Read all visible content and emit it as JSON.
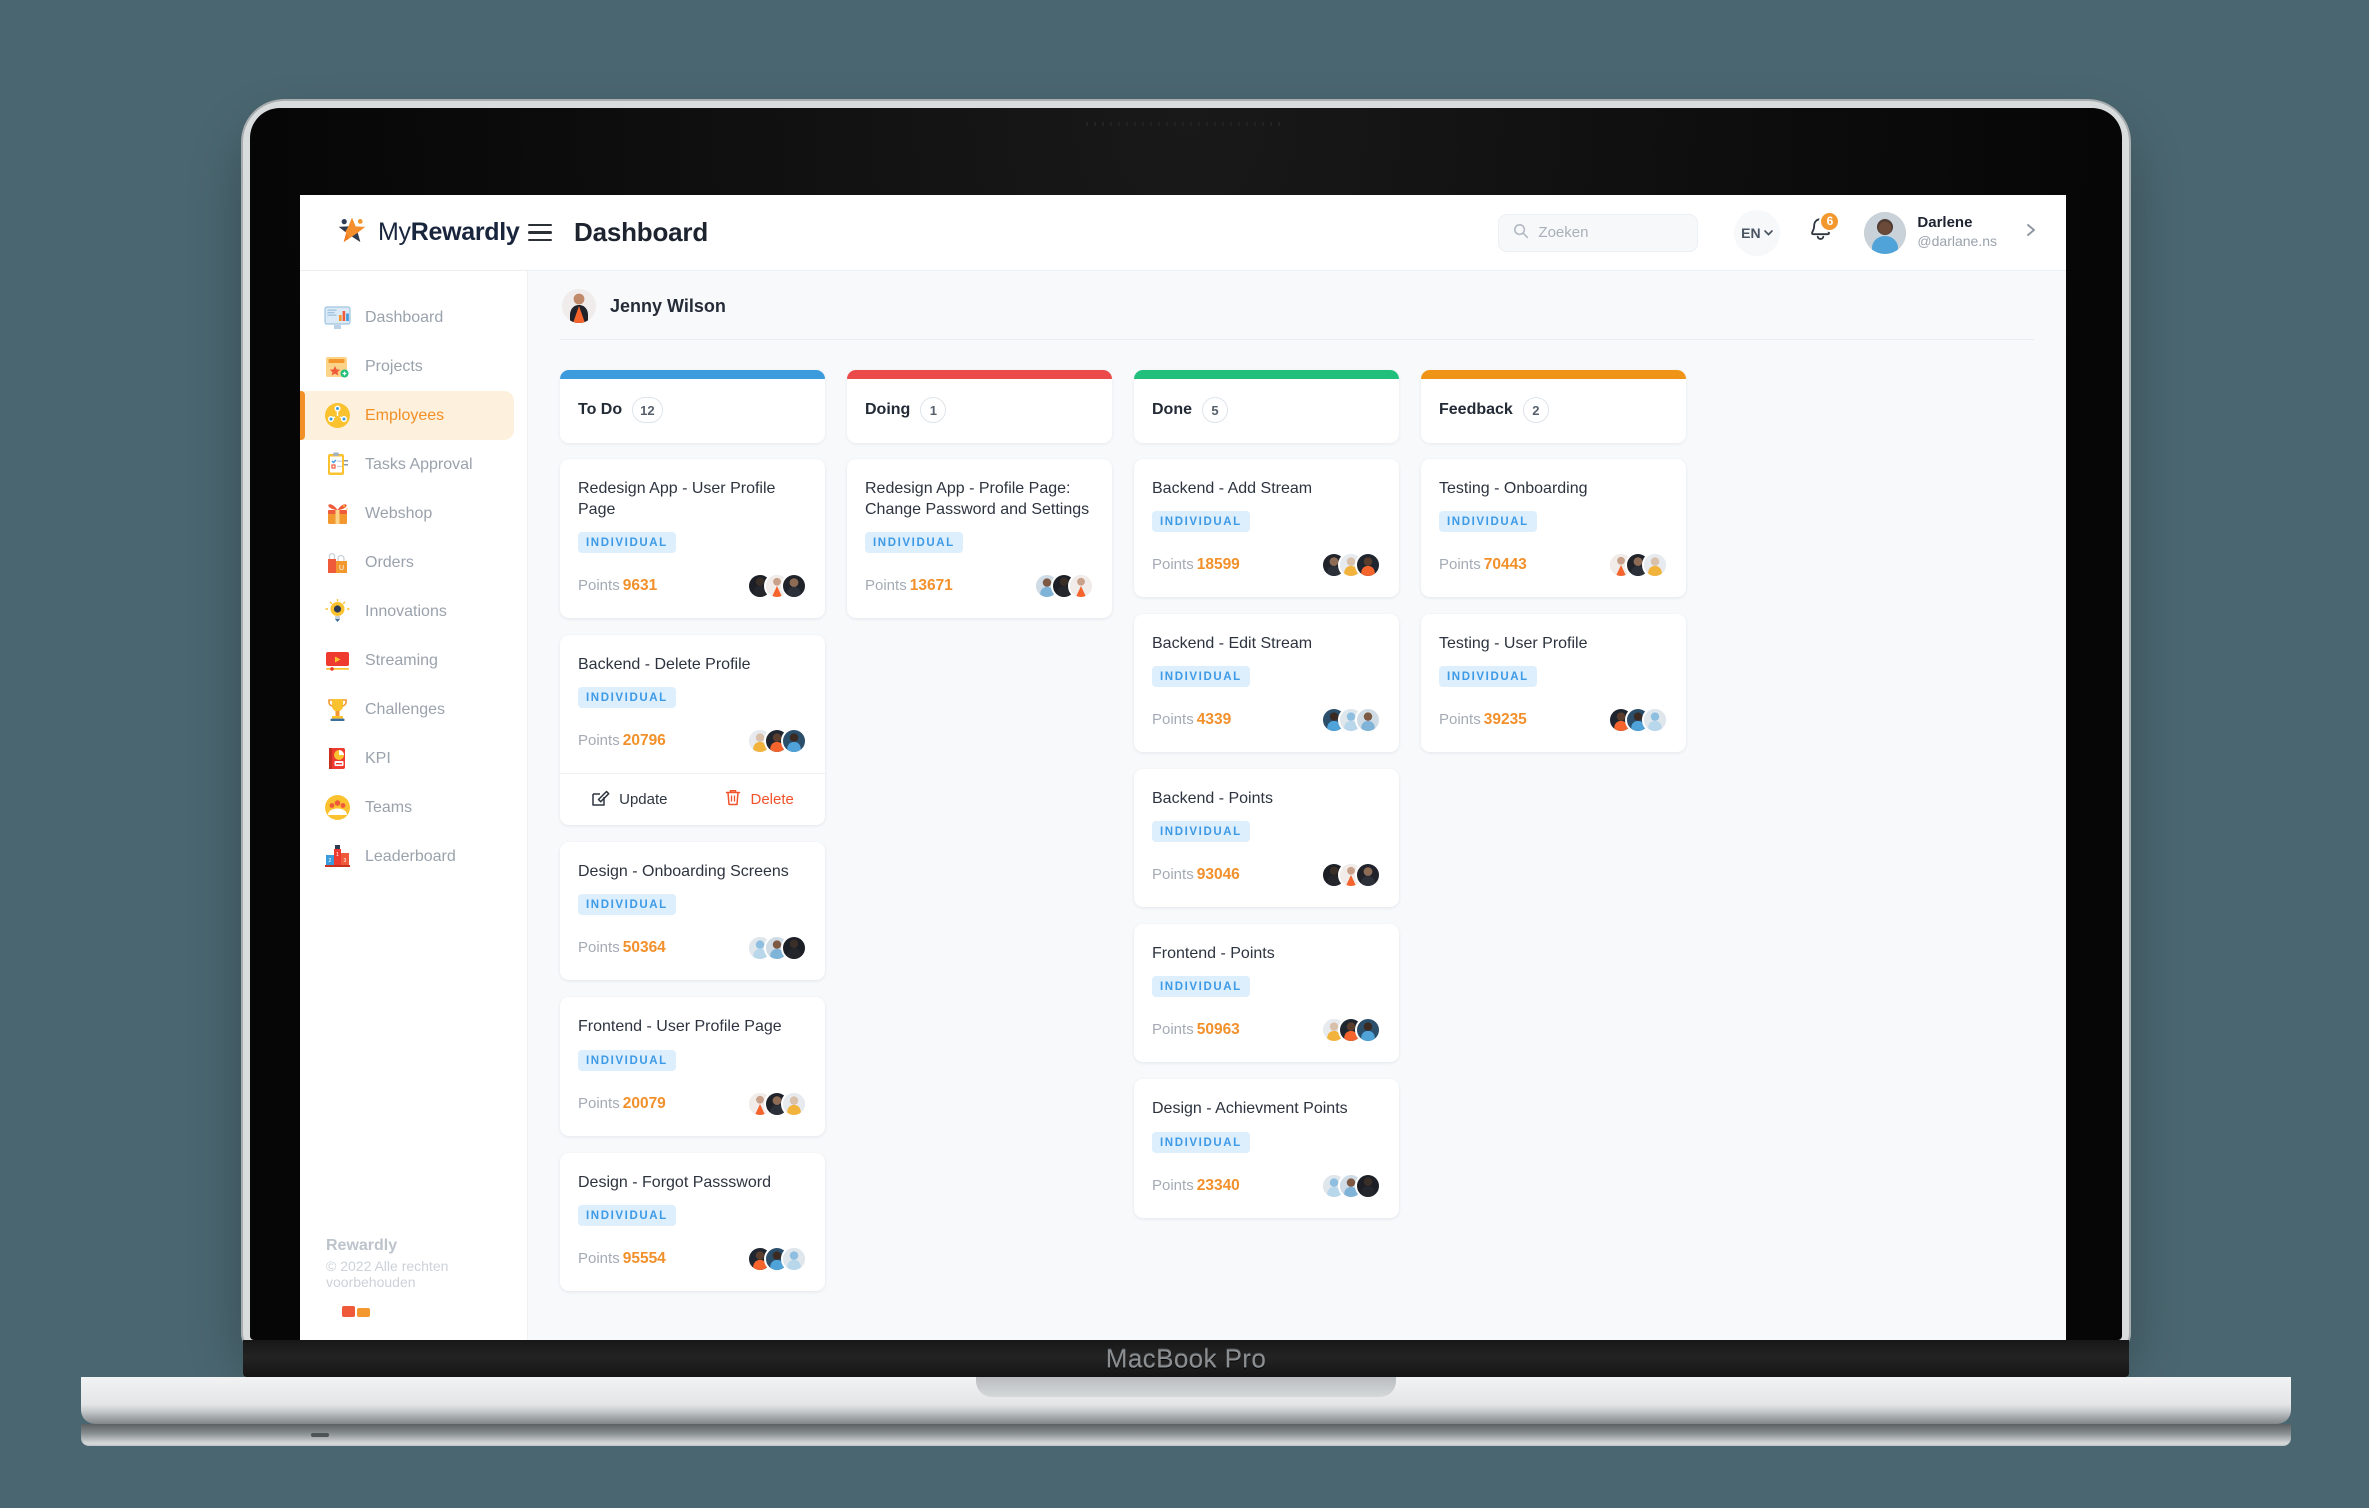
{
  "device": {
    "model_label": "MacBook Pro"
  },
  "brand": {
    "name_light": "My",
    "name_bold": "Rewardly",
    "logo_icon": "star-people-logo-icon"
  },
  "header": {
    "menu_icon": "hamburger-menu-icon",
    "title": "Dashboard",
    "search": {
      "placeholder": "Zoeken",
      "value": "",
      "icon": "search-icon"
    },
    "language": {
      "label": "EN",
      "chevron_icon": "chevron-down-icon"
    },
    "notifications": {
      "icon": "bell-icon",
      "count": "6",
      "badge_color": "#f2982f"
    },
    "user": {
      "name": "Darlene",
      "handle": "@darlane.ns",
      "avatar_icon": "user-avatar",
      "chevron_icon": "chevron-right-icon"
    }
  },
  "sidebar": {
    "items": [
      {
        "label": "Dashboard",
        "icon": "monitor-chart-icon",
        "active": false
      },
      {
        "label": "Projects",
        "icon": "folder-star-icon",
        "active": false
      },
      {
        "label": "Employees",
        "icon": "people-network-icon",
        "active": true
      },
      {
        "label": "Tasks Approval",
        "icon": "clipboard-check-icon",
        "active": false
      },
      {
        "label": "Webshop",
        "icon": "gift-box-icon",
        "active": false
      },
      {
        "label": "Orders",
        "icon": "shopping-bags-icon",
        "active": false
      },
      {
        "label": "Innovations",
        "icon": "lightbulb-gear-icon",
        "active": false
      },
      {
        "label": "Streaming",
        "icon": "video-player-icon",
        "active": false
      },
      {
        "label": "Challenges",
        "icon": "trophy-icon",
        "active": false
      },
      {
        "label": "KPI",
        "icon": "report-chart-icon",
        "active": false
      },
      {
        "label": "Teams",
        "icon": "team-group-icon",
        "active": false
      },
      {
        "label": "Leaderboard",
        "icon": "podium-icon",
        "active": false
      }
    ],
    "footer": {
      "brand": "Rewardly",
      "copyright": "© 2022 Alle rechten voorbehouden"
    },
    "active_color": "#f29026",
    "active_bg": "#fdf0dd"
  },
  "main": {
    "assignee": {
      "name": "Jenny Wilson",
      "avatar_icon": "user-avatar"
    },
    "tag_label": "INDIVIDUAL",
    "points_label": "Points",
    "actions": {
      "update_label": "Update",
      "update_icon": "edit-pencil-icon",
      "delete_label": "Delete",
      "delete_icon": "trash-bin-icon"
    },
    "columns": [
      {
        "label": "To Do",
        "count": "12",
        "color": "#3b9bdc",
        "cards": [
          {
            "title": "Redesign App - User Profile Page",
            "tag": "INDIVIDUAL",
            "points": "9631",
            "avatars": 3,
            "has_actions": false
          },
          {
            "title": "Backend - Delete Profile",
            "tag": "INDIVIDUAL",
            "points": "20796",
            "avatars": 3,
            "has_actions": true
          },
          {
            "title": "Design - Onboarding Screens",
            "tag": "INDIVIDUAL",
            "points": "50364",
            "avatars": 3,
            "has_actions": false
          },
          {
            "title": "Frontend - User Profile Page",
            "tag": "INDIVIDUAL",
            "points": "20079",
            "avatars": 3,
            "has_actions": false
          },
          {
            "title": "Design - Forgot Passsword",
            "tag": "INDIVIDUAL",
            "points": "95554",
            "avatars": 3,
            "has_actions": false
          }
        ]
      },
      {
        "label": "Doing",
        "count": "1",
        "color": "#ea4a4a",
        "cards": [
          {
            "title": "Redesign App - Profile Page: Change Password and Settings",
            "tag": "INDIVIDUAL",
            "points": "13671",
            "avatars": 3,
            "has_actions": false
          }
        ]
      },
      {
        "label": "Done",
        "count": "5",
        "color": "#20c07c",
        "cards": [
          {
            "title": "Backend - Add Stream",
            "tag": "INDIVIDUAL",
            "points": "18599",
            "avatars": 3,
            "has_actions": false
          },
          {
            "title": "Backend - Edit Stream",
            "tag": "INDIVIDUAL",
            "points": "4339",
            "avatars": 3,
            "has_actions": false
          },
          {
            "title": "Backend - Points",
            "tag": "INDIVIDUAL",
            "points": "93046",
            "avatars": 3,
            "has_actions": false
          },
          {
            "title": "Frontend - Points",
            "tag": "INDIVIDUAL",
            "points": "50963",
            "avatars": 3,
            "has_actions": false
          },
          {
            "title": "Design - Achievment Points",
            "tag": "INDIVIDUAL",
            "points": "23340",
            "avatars": 3,
            "has_actions": false
          }
        ]
      },
      {
        "label": "Feedback",
        "count": "2",
        "color": "#f09418",
        "cards": [
          {
            "title": "Testing - Onboarding",
            "tag": "INDIVIDUAL",
            "points": "70443",
            "avatars": 3,
            "has_actions": false
          },
          {
            "title": "Testing - User Profile",
            "tag": "INDIVIDUAL",
            "points": "39235",
            "avatars": 3,
            "has_actions": false
          }
        ]
      }
    ]
  }
}
